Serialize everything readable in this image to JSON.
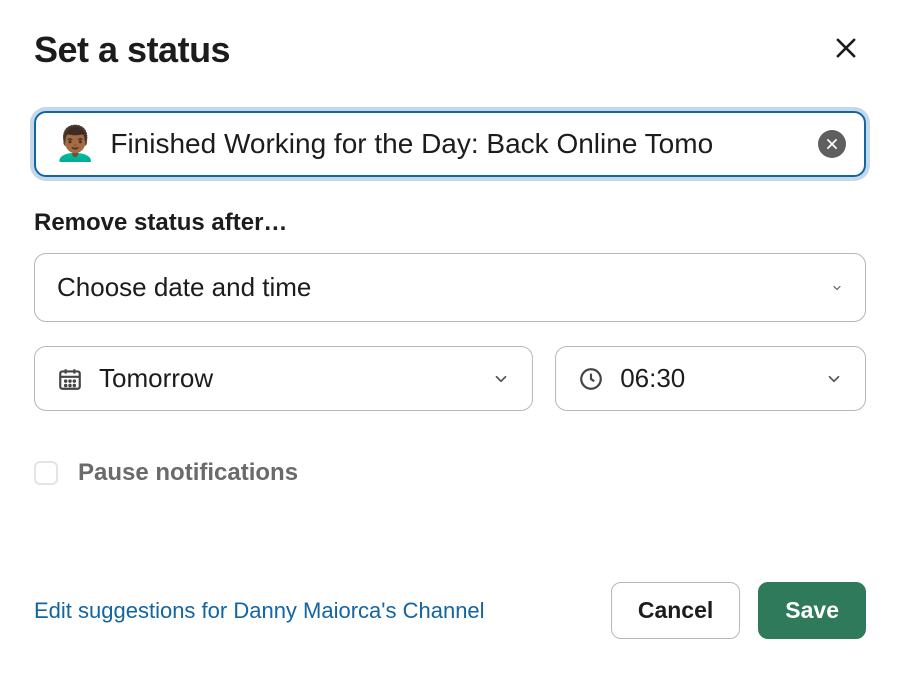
{
  "dialog": {
    "title": "Set a status"
  },
  "status": {
    "emoji": "👨🏾‍🦱",
    "text": "Finished Working for the Day: Back Online Tomo"
  },
  "remove_after": {
    "label": "Remove status after…",
    "duration": "Choose date and time",
    "date": "Tomorrow",
    "time": "06:30"
  },
  "pause": {
    "label": "Pause notifications",
    "checked": false
  },
  "footer": {
    "suggestions_link": "Edit suggestions for Danny Maiorca's Channel",
    "cancel": "Cancel",
    "save": "Save"
  }
}
